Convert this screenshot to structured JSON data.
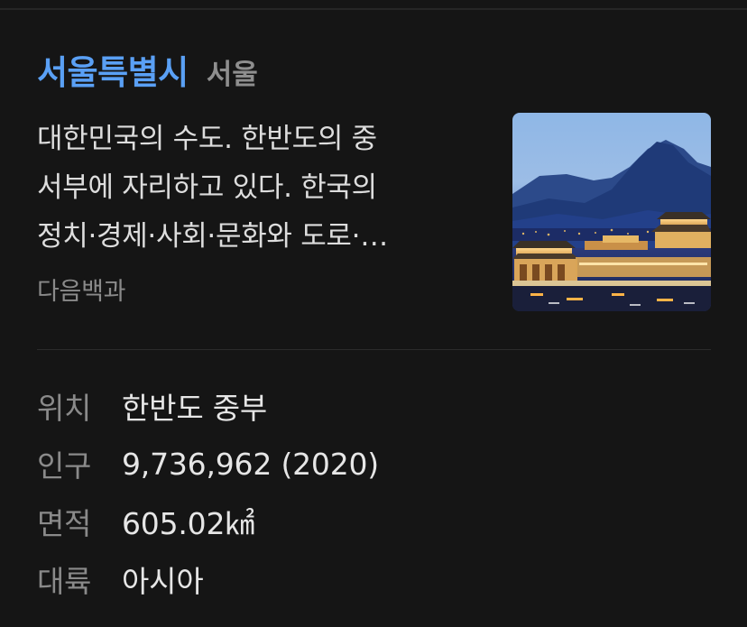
{
  "header": {
    "title": "서울특별시",
    "subtitle": "서울"
  },
  "description": {
    "lines": [
      "대한민국의 수도. 한반도의 중",
      "서부에 자리하고 있다. 한국의",
      "정치·경제·사회·문화와 도로·…"
    ],
    "source": "다음백과"
  },
  "thumbnail": {
    "icon": "seoul-gyeongbokgung-night-photo"
  },
  "info": [
    {
      "key": "위치",
      "value": "한반도 중부"
    },
    {
      "key": "인구",
      "value": "9,736,962 (2020)"
    },
    {
      "key": "면적",
      "value": "605.02㎢"
    },
    {
      "key": "대륙",
      "value": "아시아"
    }
  ],
  "colors": {
    "background": "#151515",
    "title": "#5aa0f5",
    "muted": "#8a8a8a",
    "text": "#e4e4e4"
  }
}
